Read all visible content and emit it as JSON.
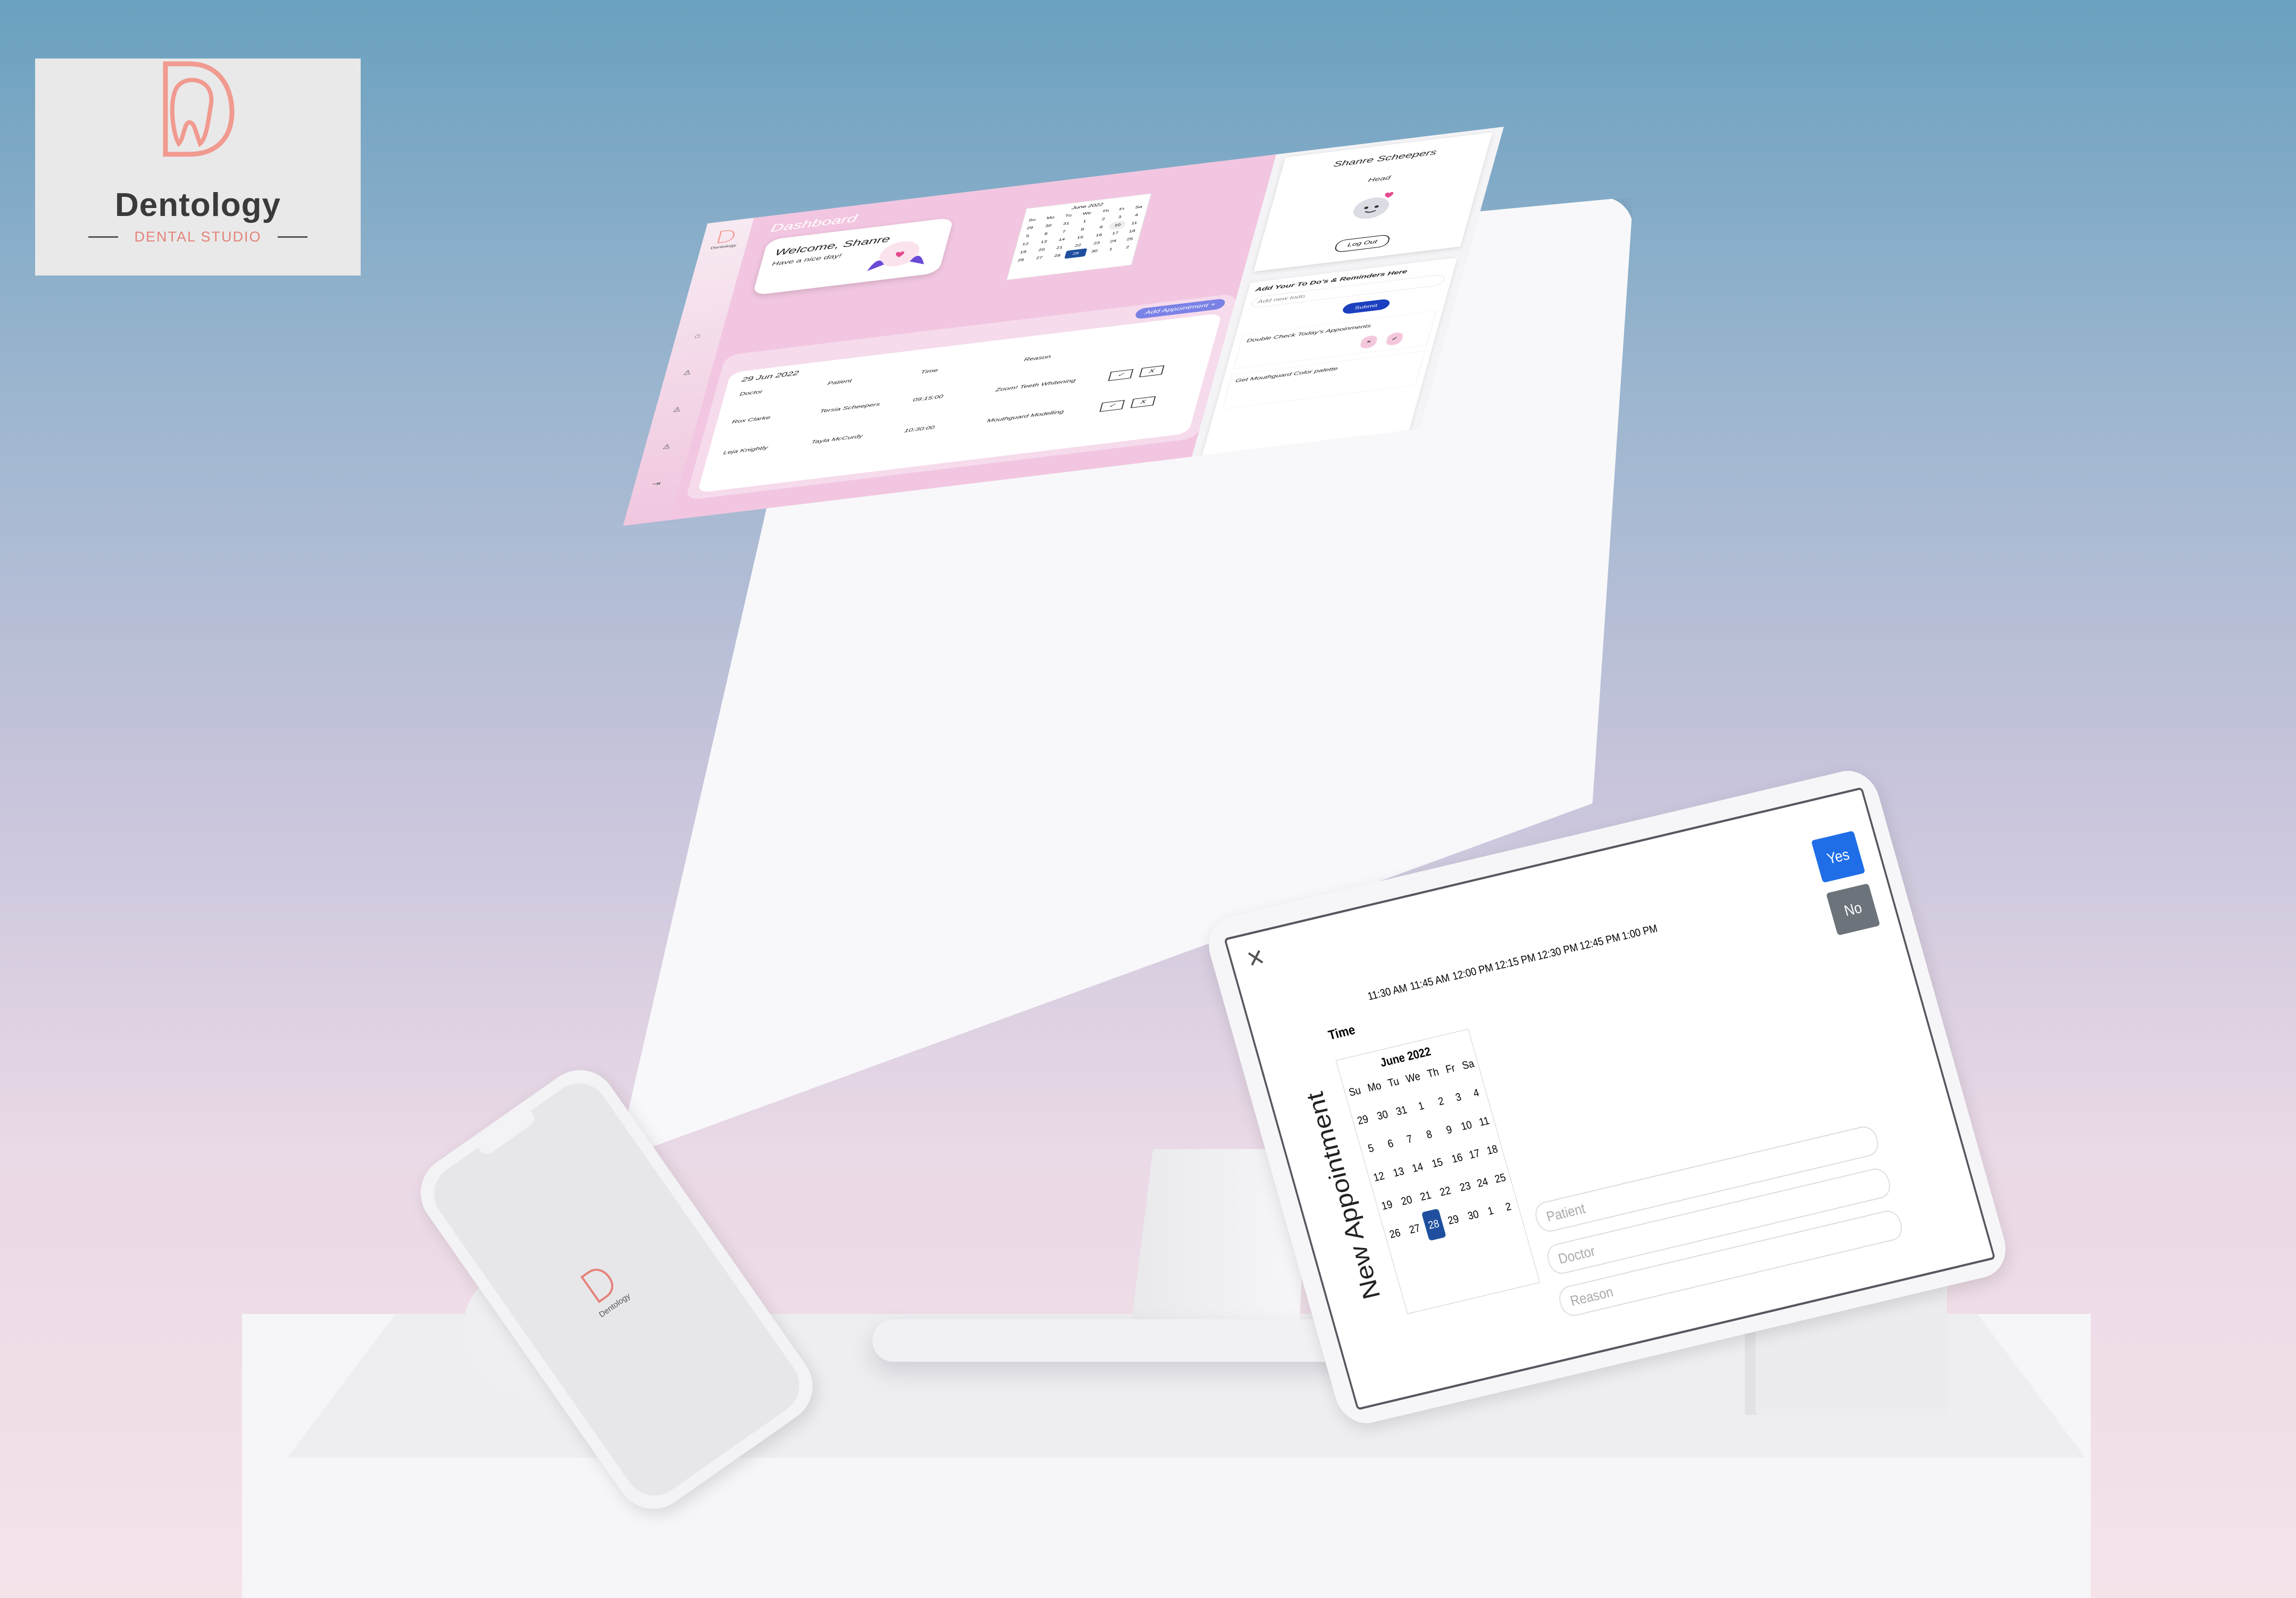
{
  "brand": {
    "name": "Dentology",
    "tagline": "DENTAL STUDIO",
    "accent": "#e4837a"
  },
  "sidebar": {
    "logo_text": "Dentology",
    "items": [
      {
        "icon": "home-icon"
      },
      {
        "icon": "user-icon"
      },
      {
        "icon": "user-icon"
      },
      {
        "icon": "user-add-icon"
      },
      {
        "icon": "logout-icon"
      }
    ]
  },
  "dashboard": {
    "title": "Dashboard",
    "welcome": {
      "heading": "Welcome, Shanre",
      "sub": "Have a nice day!"
    },
    "mini_calendar": {
      "title": "June 2022",
      "weekdays": [
        "Su",
        "Mo",
        "Tu",
        "We",
        "Th",
        "Fr",
        "Sa"
      ],
      "weeks": [
        [
          "29",
          "30",
          "31",
          "1",
          "2",
          "3",
          "4"
        ],
        [
          "5",
          "6",
          "7",
          "8",
          "9",
          "10",
          "11"
        ],
        [
          "12",
          "13",
          "14",
          "15",
          "16",
          "17",
          "18"
        ],
        [
          "19",
          "20",
          "21",
          "22",
          "23",
          "24",
          "25"
        ],
        [
          "26",
          "27",
          "28",
          "29",
          "30",
          "1",
          "2"
        ]
      ],
      "selected": "29",
      "highlight": "10"
    },
    "appointments": {
      "add_label": "Add Appointment",
      "date": "29 Jun 2022",
      "columns": [
        "Doctor",
        "Patient",
        "Time",
        "Reason"
      ],
      "rows": [
        {
          "doctor": "Rox Clarke",
          "patient": "Tersia Scheepers",
          "time": "09:15:00",
          "reason": "Zoom! Teeth Whitening"
        },
        {
          "doctor": "Leja Knightly",
          "patient": "Tayla McCurdy",
          "time": "10:30:00",
          "reason": "Mouthguard Modelling"
        }
      ],
      "accept": "✓",
      "reject": "X"
    }
  },
  "profile": {
    "name": "Shanre Scheepers",
    "role": "Head",
    "logout": "Log Out"
  },
  "todo": {
    "title": "Add Your To Do's & Reminders Here",
    "placeholder": "Add new todo",
    "submit": "Submit",
    "items": [
      {
        "text": "Double Check Today's Appoinments"
      },
      {
        "text": "Get Mouthguard Color palette"
      }
    ]
  },
  "modal": {
    "title": "New Appointment",
    "yes": "Yes",
    "no": "No",
    "fields": {
      "patient": "Patient",
      "doctor": "Doctor",
      "reason": "Reason"
    },
    "calendar": {
      "title": "June 2022",
      "weekdays": [
        "Su",
        "Mo",
        "Tu",
        "We",
        "Th",
        "Fr",
        "Sa"
      ],
      "weeks": [
        [
          "29",
          "30",
          "31",
          "1",
          "2",
          "3",
          "4"
        ],
        [
          "5",
          "6",
          "7",
          "8",
          "9",
          "10",
          "11"
        ],
        [
          "12",
          "13",
          "14",
          "15",
          "16",
          "17",
          "18"
        ],
        [
          "19",
          "20",
          "21",
          "22",
          "23",
          "24",
          "25"
        ],
        [
          "26",
          "27",
          "28",
          "29",
          "30",
          "1",
          "2"
        ]
      ],
      "selected": "28"
    },
    "time_header": "Time",
    "times": [
      "11:30 AM",
      "11:45 AM",
      "12:00 PM",
      "12:15 PM",
      "12:30 PM",
      "12:45 PM",
      "1:00 PM"
    ]
  }
}
